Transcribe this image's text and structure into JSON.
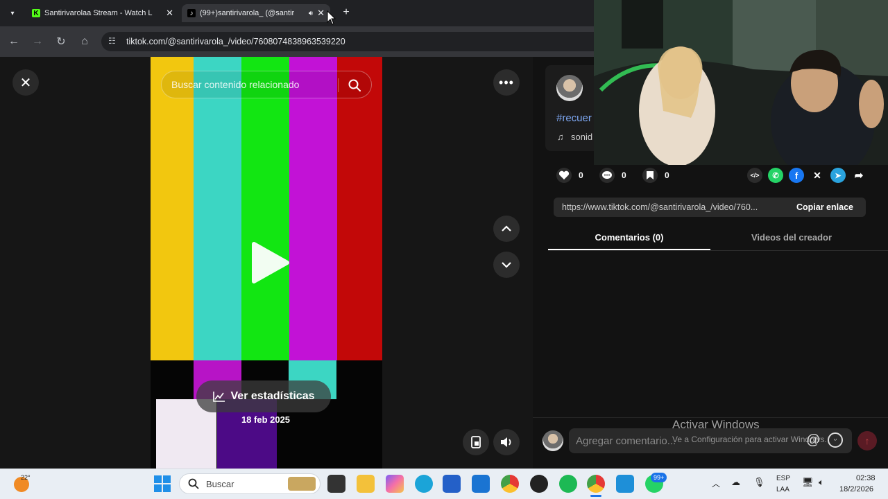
{
  "browser": {
    "tabs": [
      {
        "title": "Santirivarolaa Stream - Watch L",
        "close": "✕"
      },
      {
        "title": "(99+)santirivarola_ (@santir",
        "close": "✕"
      }
    ],
    "new_tab": "+",
    "url": "tiktok.com/@santirivarola_/video/7608074838963539220"
  },
  "video": {
    "search_placeholder": "Buscar contenido relacionado",
    "stats_label": "Ver estadísticas",
    "date": "18 feb 2025",
    "bar_colors": [
      "#f4c80f",
      "#3ed8c4",
      "#0ee80e",
      "#c40fd8",
      "#c40707"
    ]
  },
  "panel": {
    "hashtag": "#recuer",
    "sound": "sonid",
    "likes": "0",
    "comments": "0",
    "saves": "0",
    "link": "https://www.tiktok.com/@santirivarola_/video/760...",
    "copy_label": "Copiar enlace",
    "tab_comments": "Comentarios (0)",
    "tab_videos": "Videos del creador",
    "comment_placeholder": "Agregar comentario...",
    "activate_title": "Activar Windows",
    "activate_sub": "Ve a Configuración para activar Windows."
  },
  "taskbar": {
    "weather": "22°",
    "search_label": "Buscar",
    "badge": "99+",
    "lang1": "ESP",
    "lang2": "LAA",
    "time": "02:38",
    "date": "18/2/2026"
  }
}
